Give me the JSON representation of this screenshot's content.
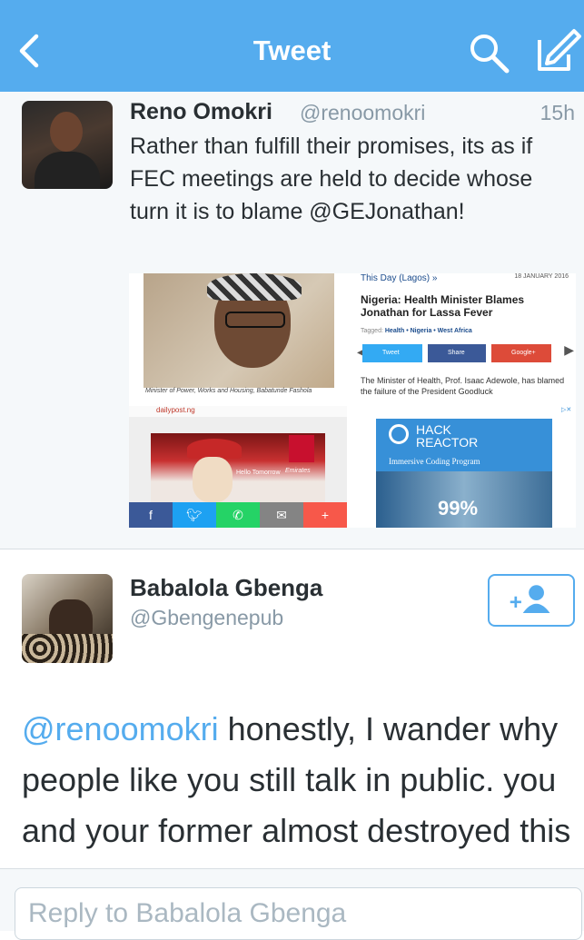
{
  "header": {
    "title": "Tweet",
    "background_color": "#55acee",
    "back_icon": "chevron-left-icon",
    "search_icon": "search-icon",
    "compose_icon": "compose-icon"
  },
  "original_tweet": {
    "name": "Reno Omokri",
    "handle": "@renoomokri",
    "time": "15h",
    "text": "Rather than fulfill their promises, its as if FEC meetings are held to decide whose turn it is to blame @GEJonathan!",
    "collage": {
      "photo_caption": "Minister of Power, Works and Housing, Babatunde Fashola",
      "article": {
        "source": "This Day (Lagos) »",
        "date": "18 JANUARY 2016",
        "headline": "Nigeria: Health Minister Blames Jonathan for Lassa Fever",
        "tagged_label": "Tagged:",
        "tags": "Health • Nigeria • West Africa",
        "share_twitter": "Tweet",
        "share_facebook": "Share",
        "share_google": "Google+",
        "body": "The Minister of Health, Prof. Isaac Adewole, has blamed the failure of the President Goodluck"
      },
      "ad_site": "dailypost.ng",
      "ad_slogan": "Hello Tomorrow",
      "ad_brand": "Emirates",
      "share_bar_icons": [
        "facebook-icon",
        "twitter-icon",
        "whatsapp-icon",
        "email-icon",
        "plus-icon"
      ],
      "hack_reactor": {
        "line1": "HACK",
        "line2": "REACTOR",
        "tagline": "Immersive Coding Program",
        "stat": "99%"
      }
    }
  },
  "reply_tweet": {
    "name": "Babalola Gbenga",
    "handle": "@Gbengenepub",
    "follow_icon": "add-user-icon",
    "mention": "@renoomokri",
    "text": " honestly, I wander why people like you still talk in public. you and your former almost destroyed this country"
  },
  "reply_box": {
    "placeholder": "Reply to Babalola Gbenga"
  }
}
